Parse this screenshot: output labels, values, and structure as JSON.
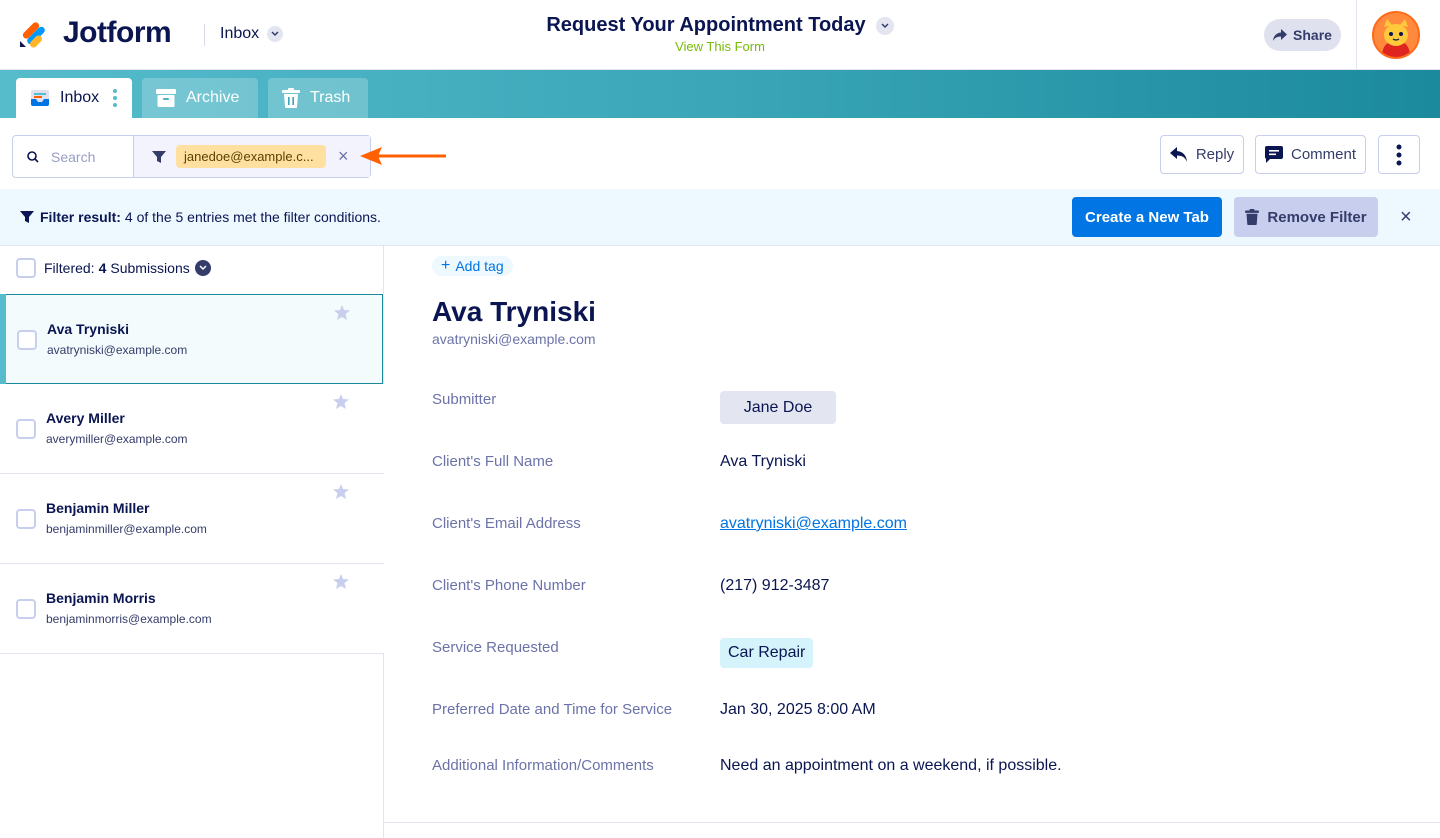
{
  "app": {
    "brand": "Jotform",
    "inbox_label": "Inbox",
    "form_title": "Request Your Appointment Today",
    "view_form": "View This Form",
    "share_label": "Share"
  },
  "tabs": [
    {
      "label": "Inbox",
      "icon": "inbox-icon"
    },
    {
      "label": "Archive",
      "icon": "archive-icon"
    },
    {
      "label": "Trash",
      "icon": "trash-icon"
    }
  ],
  "search": {
    "placeholder": "Search",
    "filter_value": "janedoe@example.c..."
  },
  "actions": {
    "reply": "Reply",
    "comment": "Comment"
  },
  "banner": {
    "label": "Filter result:",
    "text": "4 of the 5 entries met the filter conditions.",
    "create_tab": "Create a New Tab",
    "remove_filter": "Remove Filter"
  },
  "list": {
    "filtered_label": "Filtered:",
    "count": "4",
    "suffix": "Submissions",
    "items": [
      {
        "name": "Ava Tryniski",
        "email": "avatryniski@example.com"
      },
      {
        "name": "Avery Miller",
        "email": "averymiller@example.com"
      },
      {
        "name": "Benjamin Miller",
        "email": "benjaminmiller@example.com"
      },
      {
        "name": "Benjamin Morris",
        "email": "benjaminmorris@example.com"
      }
    ]
  },
  "detail": {
    "add_tag": "Add tag",
    "name": "Ava Tryniski",
    "email": "avatryniski@example.com",
    "fields": [
      {
        "label": "Submitter",
        "value": "Jane Doe"
      },
      {
        "label": "Client's Full Name",
        "value": "Ava Tryniski"
      },
      {
        "label": "Client's Email Address",
        "value": "avatryniski@example.com"
      },
      {
        "label": "Client's Phone Number",
        "value": "(217) 912-3487"
      },
      {
        "label": "Service Requested",
        "value": "Car Repair"
      },
      {
        "label": "Preferred Date and Time for Service",
        "value": "Jan 30, 2025 8:00 AM"
      },
      {
        "label": "Additional Information/Comments",
        "value": "Need an appointment on a weekend, if possible."
      }
    ]
  },
  "colors": {
    "navy": "#0a1551",
    "accent_blue": "#0075e3",
    "teal": "#56bccb",
    "filter_chip": "#ffe0a0",
    "arrow_orange": "#ff6100"
  }
}
